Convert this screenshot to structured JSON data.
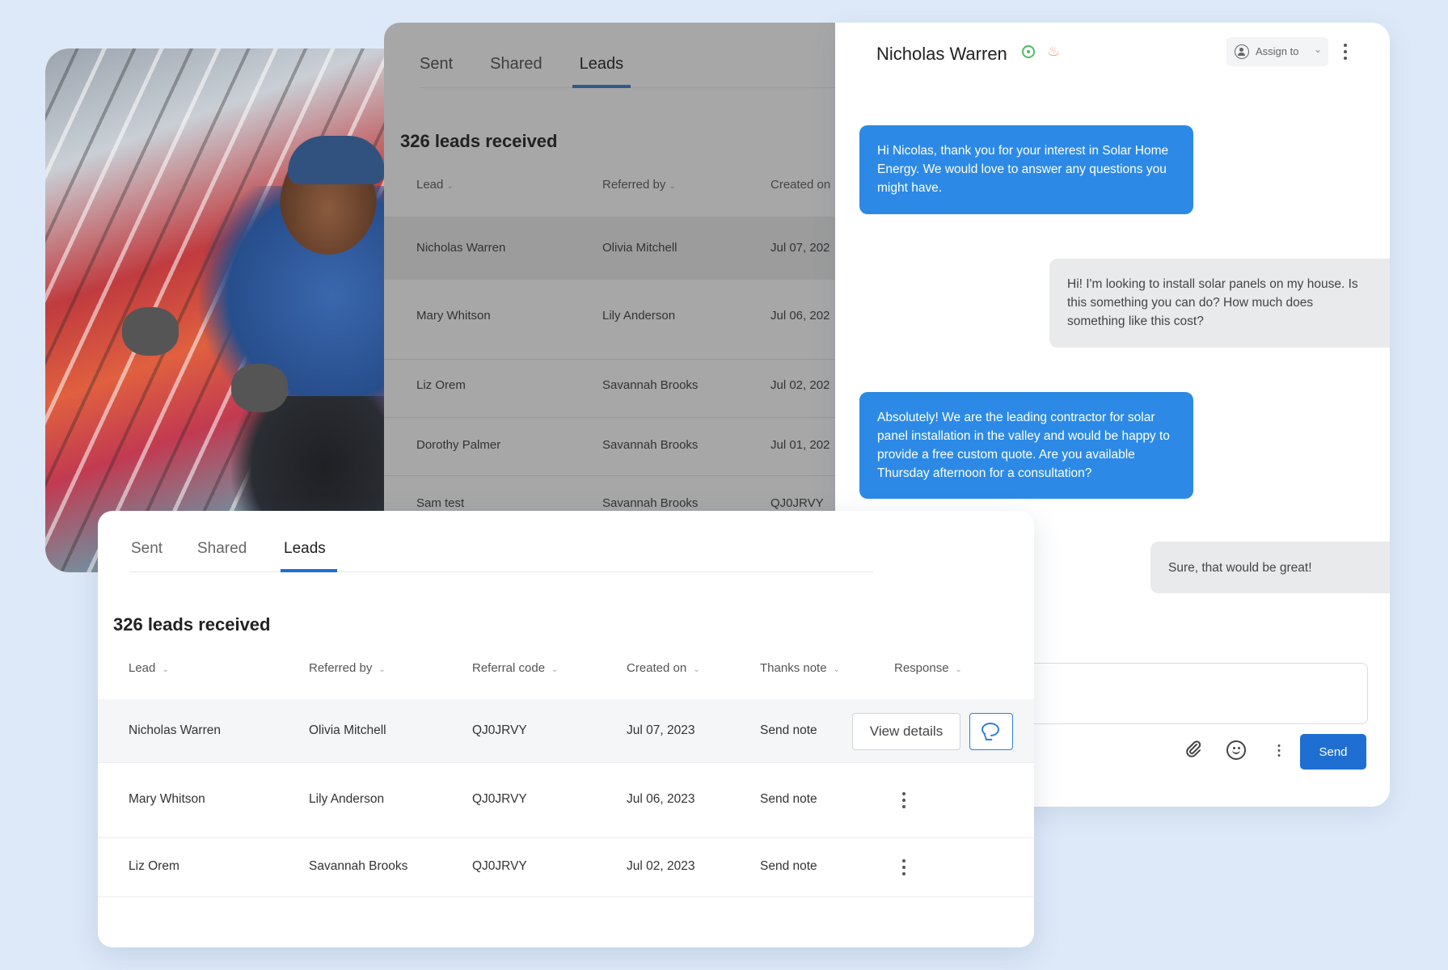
{
  "back_table": {
    "tabs": [
      "Sent",
      "Shared",
      "Leads"
    ],
    "active_tab": "Leads",
    "count_title": "326 leads received",
    "columns": [
      "Lead",
      "Referred by",
      "Created on"
    ],
    "rows": [
      {
        "lead": "Nicholas Warren",
        "referred_by": "Olivia Mitchell",
        "created_on": "Jul 07, 202"
      },
      {
        "lead": "Mary Whitson",
        "referred_by": "Lily Anderson",
        "created_on": "Jul 06, 202"
      },
      {
        "lead": "Liz Orem",
        "referred_by": "Savannah Brooks",
        "created_on": "Jul 02, 202"
      },
      {
        "lead": "Dorothy Palmer",
        "referred_by": "Savannah Brooks",
        "created_on": "Jul 01, 202"
      },
      {
        "lead": "Sam test",
        "referred_by": "Savannah Brooks",
        "created_on": "QJ0JRVY"
      }
    ]
  },
  "chat": {
    "contact_name": "Nicholas Warren",
    "assign_label": "Assign to",
    "messages": [
      {
        "direction": "out",
        "text": "Hi Nicolas, thank you for your interest in Solar Home Energy. We would love to answer any questions you might have."
      },
      {
        "direction": "in",
        "text": "Hi! I'm looking to install solar panels on my house. Is this something you can do? How much does something like this cost?"
      },
      {
        "direction": "out",
        "text": "Absolutely! We are the leading contractor for solar panel installation in the valley and would be happy to provide a free custom quote. Are you available Thursday afternoon for a consultation?"
      },
      {
        "direction": "in",
        "text": "Sure, that would be great!"
      }
    ],
    "send_label": "Send"
  },
  "front_table": {
    "tabs": [
      "Sent",
      "Shared",
      "Leads"
    ],
    "active_tab": "Leads",
    "count_title": "326 leads received",
    "columns": [
      "Lead",
      "Referred by",
      "Referral code",
      "Created on",
      "Thanks note",
      "Response"
    ],
    "rows": [
      {
        "lead": "Nicholas Warren",
        "referred_by": "Olivia Mitchell",
        "code": "QJ0JRVY",
        "created_on": "Jul 07, 2023",
        "thanks_note": "Send note"
      },
      {
        "lead": "Mary Whitson",
        "referred_by": "Lily Anderson",
        "code": "QJ0JRVY",
        "created_on": "Jul 06, 2023",
        "thanks_note": "Send note"
      },
      {
        "lead": "Liz Orem",
        "referred_by": "Savannah Brooks",
        "code": "QJ0JRVY",
        "created_on": "Jul 02, 2023",
        "thanks_note": "Send note"
      }
    ],
    "view_details_label": "View details"
  },
  "colors": {
    "page_bg": "#dde9f8",
    "accent_blue": "#1f6fd3",
    "outgoing_bubble": "#2c8ae6",
    "incoming_bubble": "#e9eaec",
    "online_green": "#4cbd62"
  },
  "icons": [
    "user-circle-icon",
    "chevron-down-icon",
    "kebab-menu-icon",
    "paperclip-icon",
    "smiley-icon",
    "chat-bubble-icon",
    "sort-caret-icon",
    "online-status-icon",
    "flame-icon"
  ]
}
